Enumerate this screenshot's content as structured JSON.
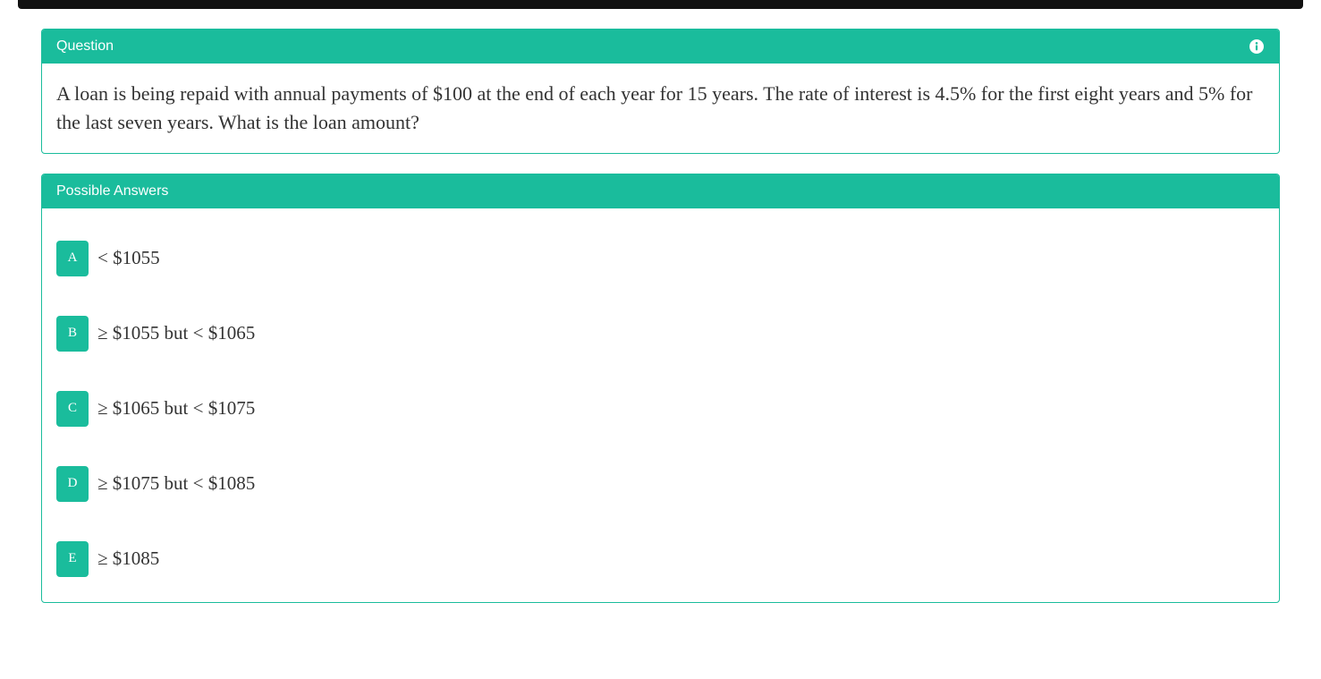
{
  "question": {
    "header": "Question",
    "text": "A loan is being repaid with annual payments of $100 at the end of each year for 15 years. The rate of interest is 4.5% for the first eight years and 5% for the last seven years. What is the loan amount?"
  },
  "answers": {
    "header": "Possible Answers",
    "options": [
      {
        "letter": "A",
        "text": "< $1055"
      },
      {
        "letter": "B",
        "text": "≥ $1055 but < $1065"
      },
      {
        "letter": "C",
        "text": "≥ $1065 but < $1075"
      },
      {
        "letter": "D",
        "text": "≥ $1075 but < $1085"
      },
      {
        "letter": "E",
        "text": "≥ $1085"
      }
    ]
  }
}
